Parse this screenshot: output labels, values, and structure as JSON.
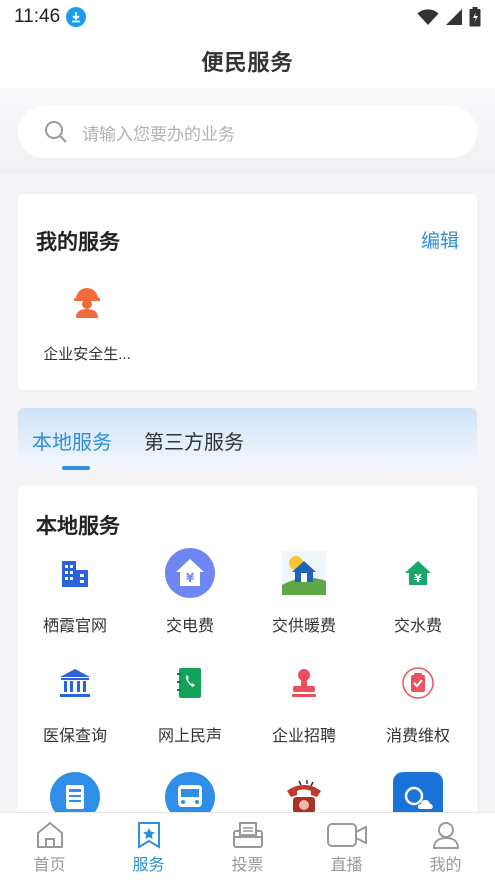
{
  "status_bar": {
    "time": "11:46"
  },
  "header": {
    "title": "便民服务"
  },
  "search": {
    "placeholder": "请输入您要办的业务"
  },
  "my_services": {
    "title": "我的服务",
    "edit_label": "编辑",
    "items": [
      {
        "label": "企业安全生...",
        "icon": "worker-icon"
      }
    ]
  },
  "tabs": [
    {
      "label": "本地服务",
      "active": true
    },
    {
      "label": "第三方服务",
      "active": false
    }
  ],
  "local_services": {
    "title": "本地服务",
    "items": [
      {
        "label": "栖霞官网",
        "icon": "building-icon"
      },
      {
        "label": "交电费",
        "icon": "electricity-fee-icon"
      },
      {
        "label": "交供暖费",
        "icon": "heating-fee-icon"
      },
      {
        "label": "交水费",
        "icon": "water-fee-icon"
      },
      {
        "label": "医保查询",
        "icon": "bank-icon"
      },
      {
        "label": "网上民声",
        "icon": "phone-book-icon"
      },
      {
        "label": "企业招聘",
        "icon": "stamp-icon"
      },
      {
        "label": "消费维权",
        "icon": "clipboard-check-icon"
      },
      {
        "label": "",
        "icon": "newspaper-icon"
      },
      {
        "label": "",
        "icon": "bus-icon"
      },
      {
        "label": "",
        "icon": "telephone-icon"
      },
      {
        "label": "",
        "icon": "weather-icon"
      }
    ]
  },
  "bottom_nav": [
    {
      "label": "首页",
      "icon": "home-icon",
      "active": false
    },
    {
      "label": "服务",
      "icon": "service-bookmark-icon",
      "active": true
    },
    {
      "label": "投票",
      "icon": "vote-box-icon",
      "active": false
    },
    {
      "label": "直播",
      "icon": "video-camera-icon",
      "active": false
    },
    {
      "label": "我的",
      "icon": "user-icon",
      "active": false
    }
  ],
  "colors": {
    "accent": "#2f8fd8",
    "background": "#f4f4f6",
    "inactive_nav": "#999999"
  }
}
